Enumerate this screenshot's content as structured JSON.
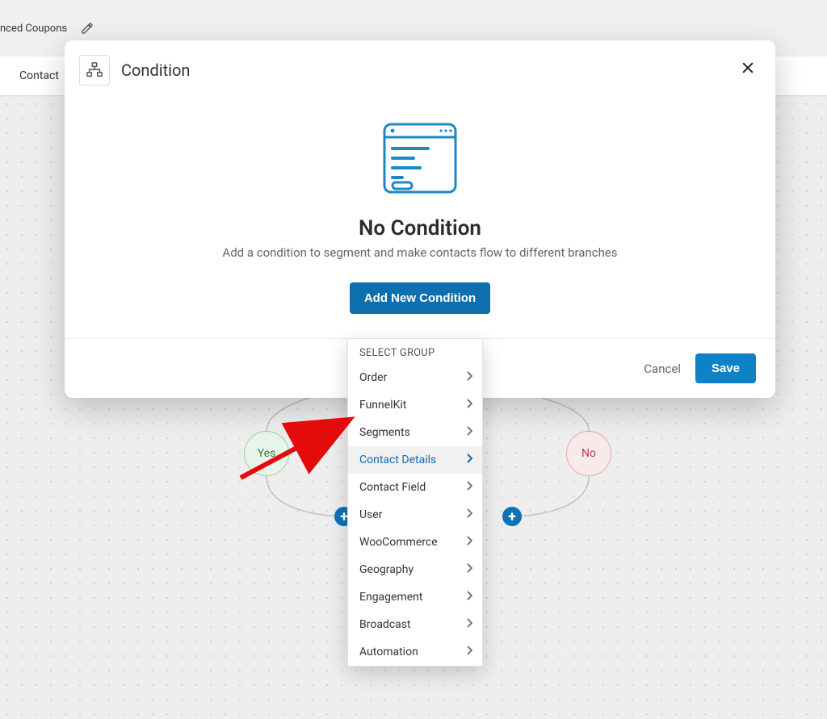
{
  "topbar": {
    "crumb_fragment": "nced Coupons"
  },
  "breadcrumb": {
    "label": "Contact"
  },
  "modal": {
    "title": "Condition",
    "empty_title": "No Condition",
    "empty_subtitle": "Add a condition to segment and make contacts flow to different branches",
    "add_button": "Add New Condition",
    "cancel": "Cancel",
    "save": "Save"
  },
  "dropdown": {
    "header": "SELECT GROUP",
    "items": [
      {
        "label": "Order",
        "active": false
      },
      {
        "label": "FunnelKit",
        "active": false
      },
      {
        "label": "Segments",
        "active": false
      },
      {
        "label": "Contact Details",
        "active": true
      },
      {
        "label": "Contact Field",
        "active": false
      },
      {
        "label": "User",
        "active": false
      },
      {
        "label": "WooCommerce",
        "active": false
      },
      {
        "label": "Geography",
        "active": false
      },
      {
        "label": "Engagement",
        "active": false
      },
      {
        "label": "Broadcast",
        "active": false
      },
      {
        "label": "Automation",
        "active": false
      }
    ]
  },
  "flow": {
    "yes": "Yes",
    "no": "No"
  }
}
